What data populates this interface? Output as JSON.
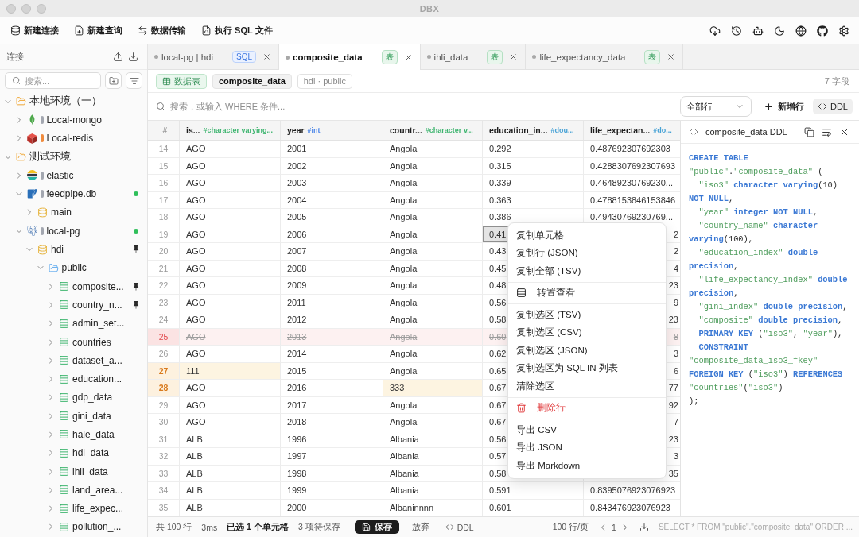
{
  "window": {
    "title": "DBX"
  },
  "toolbar": {
    "actions": [
      {
        "kind": "new-connection",
        "label": "新建连接"
      },
      {
        "kind": "new-query",
        "label": "新建查询"
      },
      {
        "kind": "transfer",
        "label": "数据传输"
      },
      {
        "kind": "run-file",
        "label": "执行 SQL 文件"
      }
    ]
  },
  "sidebar": {
    "title": "连接",
    "search": {
      "placeholder": "搜索..."
    },
    "tree": [
      {
        "kind": "group",
        "label": "本地环境（一）",
        "expanded": true,
        "children": [
          {
            "kind": "mongodb",
            "label": "Local-mongo",
            "color": "#a3a7b0",
            "expanded": false,
            "connected": false
          },
          {
            "kind": "redis",
            "label": "Local-redis",
            "color": "#ef8a3c",
            "expanded": false,
            "connected": false
          }
        ]
      },
      {
        "kind": "group",
        "label": "测试环境",
        "expanded": true,
        "children": [
          {
            "kind": "elasticsearch",
            "label": "elastic",
            "color": "#a3a7b0",
            "expanded": false,
            "connected": false
          },
          {
            "kind": "sqlite",
            "label": "feedpipe.db",
            "color": "#a3a7b0",
            "expanded": true,
            "connected": true,
            "children": [
              {
                "kind": "database",
                "label": "main",
                "expanded": false,
                "pinned": false
              }
            ]
          },
          {
            "kind": "postgres",
            "label": "local-pg",
            "color": "#a3a7b0",
            "expanded": true,
            "connected": true,
            "children": [
              {
                "kind": "database",
                "label": "hdi",
                "expanded": true,
                "pinned": true,
                "children": [
                  {
                    "kind": "schema",
                    "label": "public",
                    "expanded": true,
                    "children": [
                      {
                        "kind": "table",
                        "label": "composite...",
                        "expanded": false,
                        "pinned": true
                      },
                      {
                        "kind": "table",
                        "label": "country_n...",
                        "expanded": false,
                        "pinned": true
                      },
                      {
                        "kind": "table",
                        "label": "admin_set...",
                        "expanded": false,
                        "pinned": false
                      },
                      {
                        "kind": "table",
                        "label": "countries",
                        "expanded": false,
                        "pinned": false
                      },
                      {
                        "kind": "table",
                        "label": "dataset_a...",
                        "expanded": false,
                        "pinned": false
                      },
                      {
                        "kind": "table",
                        "label": "education...",
                        "expanded": false,
                        "pinned": false
                      },
                      {
                        "kind": "table",
                        "label": "gdp_data",
                        "expanded": false,
                        "pinned": false
                      },
                      {
                        "kind": "table",
                        "label": "gini_data",
                        "expanded": false,
                        "pinned": false
                      },
                      {
                        "kind": "table",
                        "label": "hale_data",
                        "expanded": false,
                        "pinned": false
                      },
                      {
                        "kind": "table",
                        "label": "hdi_data",
                        "expanded": false,
                        "pinned": false
                      },
                      {
                        "kind": "table",
                        "label": "ihli_data",
                        "expanded": false,
                        "pinned": false
                      },
                      {
                        "kind": "table",
                        "label": "land_area...",
                        "expanded": false,
                        "pinned": false
                      },
                      {
                        "kind": "table",
                        "label": "life_expec...",
                        "expanded": false,
                        "pinned": false
                      },
                      {
                        "kind": "table",
                        "label": "pollution_...",
                        "expanded": false,
                        "pinned": false
                      }
                    ]
                  }
                ]
              }
            ]
          }
        ]
      }
    ]
  },
  "tabs": [
    {
      "label": "local-pg | hdi",
      "badge": "SQL",
      "kind": "sql",
      "selected": false
    },
    {
      "label": "composite_data",
      "badge": "表",
      "kind": "table",
      "selected": true
    },
    {
      "label": "ihli_data",
      "badge": "表",
      "kind": "table",
      "selected": false
    },
    {
      "label": "life_expectancy_data",
      "badge": "表",
      "kind": "table",
      "selected": false
    }
  ],
  "object_bar": {
    "type_chip": "数据表",
    "name_chip": "composite_data",
    "path_chip": "hdi · public",
    "field_count": "7 字段"
  },
  "filter_bar": {
    "placeholder": "搜索，或输入 WHERE 条件...",
    "row_filter": "全部行",
    "add_row": "新增行",
    "ddl_toggle": {
      "label": "DDL",
      "on": true
    }
  },
  "table": {
    "number_header": "#",
    "columns": [
      {
        "label": "is...",
        "type": "#character varying...",
        "color": "#3cb46e"
      },
      {
        "label": "year",
        "type": "#int",
        "color": "#4c86e8"
      },
      {
        "label": "countr...",
        "type": "#character v...",
        "color": "#3cb46e"
      },
      {
        "label": "education_in...",
        "type": "#dou...",
        "color": "#49a3d6"
      },
      {
        "label": "life_expectan...",
        "type": "#do...",
        "color": "#49a3d6"
      }
    ],
    "rows": [
      {
        "number": "14",
        "deleted": false,
        "modified": false,
        "under_menu": false,
        "cells": [
          {
            "text": "AGO",
            "selected": false,
            "edited": false
          },
          {
            "text": "2001",
            "selected": false,
            "edited": false
          },
          {
            "text": "Angola",
            "selected": false,
            "edited": false
          },
          {
            "text": "0.292",
            "selected": false,
            "edited": false
          },
          {
            "text": "0.487692307692303",
            "selected": false,
            "edited": false
          }
        ]
      },
      {
        "number": "15",
        "deleted": false,
        "modified": false,
        "under_menu": false,
        "cells": [
          {
            "text": "AGO",
            "selected": false,
            "edited": false
          },
          {
            "text": "2002",
            "selected": false,
            "edited": false
          },
          {
            "text": "Angola",
            "selected": false,
            "edited": false
          },
          {
            "text": "0.315",
            "selected": false,
            "edited": false
          },
          {
            "text": "0.4288307692307693",
            "selected": false,
            "edited": false
          }
        ]
      },
      {
        "number": "16",
        "deleted": false,
        "modified": false,
        "under_menu": false,
        "cells": [
          {
            "text": "AGO",
            "selected": false,
            "edited": false
          },
          {
            "text": "2003",
            "selected": false,
            "edited": false
          },
          {
            "text": "Angola",
            "selected": false,
            "edited": false
          },
          {
            "text": "0.339",
            "selected": false,
            "edited": false
          },
          {
            "text": "0.46489230769230...",
            "selected": false,
            "edited": false
          }
        ]
      },
      {
        "number": "17",
        "deleted": false,
        "modified": false,
        "under_menu": false,
        "cells": [
          {
            "text": "AGO",
            "selected": false,
            "edited": false
          },
          {
            "text": "2004",
            "selected": false,
            "edited": false
          },
          {
            "text": "Angola",
            "selected": false,
            "edited": false
          },
          {
            "text": "0.363",
            "selected": false,
            "edited": false
          },
          {
            "text": "0.4788153846153846",
            "selected": false,
            "edited": false
          }
        ]
      },
      {
        "number": "18",
        "deleted": false,
        "modified": false,
        "under_menu": false,
        "cells": [
          {
            "text": "AGO",
            "selected": false,
            "edited": false
          },
          {
            "text": "2005",
            "selected": false,
            "edited": false
          },
          {
            "text": "Angola",
            "selected": false,
            "edited": false
          },
          {
            "text": "0.386",
            "selected": false,
            "edited": false
          },
          {
            "text": "0.49430769230769...",
            "selected": false,
            "edited": false
          }
        ]
      },
      {
        "number": "19",
        "deleted": false,
        "modified": false,
        "under_menu": true,
        "cells": [
          {
            "text": "AGO",
            "selected": false,
            "edited": false
          },
          {
            "text": "2006",
            "selected": false,
            "edited": false
          },
          {
            "text": "Angola",
            "selected": false,
            "edited": false
          },
          {
            "text": "0.41",
            "selected": true,
            "edited": false
          },
          {
            "text": "2",
            "selected": false,
            "edited": false
          }
        ]
      },
      {
        "number": "20",
        "deleted": false,
        "modified": false,
        "under_menu": true,
        "cells": [
          {
            "text": "AGO",
            "selected": false,
            "edited": false
          },
          {
            "text": "2007",
            "selected": false,
            "edited": false
          },
          {
            "text": "Angola",
            "selected": false,
            "edited": false
          },
          {
            "text": "0.43",
            "selected": false,
            "edited": false
          },
          {
            "text": "2",
            "selected": false,
            "edited": false
          }
        ]
      },
      {
        "number": "21",
        "deleted": false,
        "modified": false,
        "under_menu": true,
        "cells": [
          {
            "text": "AGO",
            "selected": false,
            "edited": false
          },
          {
            "text": "2008",
            "selected": false,
            "edited": false
          },
          {
            "text": "Angola",
            "selected": false,
            "edited": false
          },
          {
            "text": "0.45",
            "selected": false,
            "edited": false
          },
          {
            "text": "4",
            "selected": false,
            "edited": false
          }
        ]
      },
      {
        "number": "22",
        "deleted": false,
        "modified": false,
        "under_menu": true,
        "cells": [
          {
            "text": "AGO",
            "selected": false,
            "edited": false
          },
          {
            "text": "2009",
            "selected": false,
            "edited": false
          },
          {
            "text": "Angola",
            "selected": false,
            "edited": false
          },
          {
            "text": "0.48",
            "selected": false,
            "edited": false
          },
          {
            "text": "23",
            "selected": false,
            "edited": false
          }
        ]
      },
      {
        "number": "23",
        "deleted": false,
        "modified": false,
        "under_menu": true,
        "cells": [
          {
            "text": "AGO",
            "selected": false,
            "edited": false
          },
          {
            "text": "2011",
            "selected": false,
            "edited": false
          },
          {
            "text": "Angola",
            "selected": false,
            "edited": false
          },
          {
            "text": "0.56",
            "selected": false,
            "edited": false
          },
          {
            "text": "9",
            "selected": false,
            "edited": false
          }
        ]
      },
      {
        "number": "24",
        "deleted": false,
        "modified": false,
        "under_menu": true,
        "cells": [
          {
            "text": "AGO",
            "selected": false,
            "edited": false
          },
          {
            "text": "2012",
            "selected": false,
            "edited": false
          },
          {
            "text": "Angola",
            "selected": false,
            "edited": false
          },
          {
            "text": "0.58",
            "selected": false,
            "edited": false
          },
          {
            "text": "23",
            "selected": false,
            "edited": false
          }
        ]
      },
      {
        "number": "25",
        "deleted": true,
        "modified": false,
        "under_menu": true,
        "cells": [
          {
            "text": "AGO",
            "selected": false,
            "edited": false
          },
          {
            "text": "2013",
            "selected": false,
            "edited": false
          },
          {
            "text": "Angola",
            "selected": false,
            "edited": false
          },
          {
            "text": "0.60",
            "selected": false,
            "edited": false
          },
          {
            "text": "8",
            "selected": false,
            "edited": false
          }
        ]
      },
      {
        "number": "26",
        "deleted": false,
        "modified": false,
        "under_menu": true,
        "cells": [
          {
            "text": "AGO",
            "selected": false,
            "edited": false
          },
          {
            "text": "2014",
            "selected": false,
            "edited": false
          },
          {
            "text": "Angola",
            "selected": false,
            "edited": false
          },
          {
            "text": "0.62",
            "selected": false,
            "edited": false
          },
          {
            "text": "3",
            "selected": false,
            "edited": false
          }
        ]
      },
      {
        "number": "27",
        "deleted": false,
        "modified": true,
        "under_menu": true,
        "cells": [
          {
            "text": "111",
            "selected": false,
            "edited": true
          },
          {
            "text": "2015",
            "selected": false,
            "edited": false
          },
          {
            "text": "Angola",
            "selected": false,
            "edited": false
          },
          {
            "text": "0.65",
            "selected": false,
            "edited": false
          },
          {
            "text": "6",
            "selected": false,
            "edited": false
          }
        ]
      },
      {
        "number": "28",
        "deleted": false,
        "modified": true,
        "under_menu": true,
        "cells": [
          {
            "text": "AGO",
            "selected": false,
            "edited": false
          },
          {
            "text": "2016",
            "selected": false,
            "edited": false
          },
          {
            "text": "333",
            "selected": false,
            "edited": true
          },
          {
            "text": "0.67",
            "selected": false,
            "edited": false
          },
          {
            "text": "77",
            "selected": false,
            "edited": false
          }
        ]
      },
      {
        "number": "29",
        "deleted": false,
        "modified": false,
        "under_menu": true,
        "cells": [
          {
            "text": "AGO",
            "selected": false,
            "edited": false
          },
          {
            "text": "2017",
            "selected": false,
            "edited": false
          },
          {
            "text": "Angola",
            "selected": false,
            "edited": false
          },
          {
            "text": "0.67",
            "selected": false,
            "edited": false
          },
          {
            "text": "92",
            "selected": false,
            "edited": false
          }
        ]
      },
      {
        "number": "30",
        "deleted": false,
        "modified": false,
        "under_menu": true,
        "cells": [
          {
            "text": "AGO",
            "selected": false,
            "edited": false
          },
          {
            "text": "2018",
            "selected": false,
            "edited": false
          },
          {
            "text": "Angola",
            "selected": false,
            "edited": false
          },
          {
            "text": "0.67",
            "selected": false,
            "edited": false
          },
          {
            "text": "7",
            "selected": false,
            "edited": false
          }
        ]
      },
      {
        "number": "31",
        "deleted": false,
        "modified": false,
        "under_menu": true,
        "cells": [
          {
            "text": "ALB",
            "selected": false,
            "edited": false
          },
          {
            "text": "1996",
            "selected": false,
            "edited": false
          },
          {
            "text": "Albania",
            "selected": false,
            "edited": false
          },
          {
            "text": "0.56",
            "selected": false,
            "edited": false
          },
          {
            "text": "23",
            "selected": false,
            "edited": false
          }
        ]
      },
      {
        "number": "32",
        "deleted": false,
        "modified": false,
        "under_menu": true,
        "cells": [
          {
            "text": "ALB",
            "selected": false,
            "edited": false
          },
          {
            "text": "1997",
            "selected": false,
            "edited": false
          },
          {
            "text": "Albania",
            "selected": false,
            "edited": false
          },
          {
            "text": "0.57",
            "selected": false,
            "edited": false
          },
          {
            "text": "3",
            "selected": false,
            "edited": false
          }
        ]
      },
      {
        "number": "33",
        "deleted": false,
        "modified": false,
        "under_menu": true,
        "cells": [
          {
            "text": "ALB",
            "selected": false,
            "edited": false
          },
          {
            "text": "1998",
            "selected": false,
            "edited": false
          },
          {
            "text": "Albania",
            "selected": false,
            "edited": false
          },
          {
            "text": "0.58",
            "selected": false,
            "edited": false
          },
          {
            "text": "35",
            "selected": false,
            "edited": false
          }
        ]
      },
      {
        "number": "34",
        "deleted": false,
        "modified": false,
        "under_menu": false,
        "cells": [
          {
            "text": "ALB",
            "selected": false,
            "edited": false
          },
          {
            "text": "1999",
            "selected": false,
            "edited": false
          },
          {
            "text": "Albania",
            "selected": false,
            "edited": false
          },
          {
            "text": "0.591",
            "selected": false,
            "edited": false
          },
          {
            "text": "0.8395076923076923",
            "selected": false,
            "edited": false
          }
        ]
      },
      {
        "number": "35",
        "deleted": false,
        "modified": false,
        "under_menu": false,
        "cells": [
          {
            "text": "ALB",
            "selected": false,
            "edited": false
          },
          {
            "text": "2000",
            "selected": false,
            "edited": false
          },
          {
            "text": "Albaninnnn",
            "selected": false,
            "edited": false
          },
          {
            "text": "0.601",
            "selected": false,
            "edited": false
          },
          {
            "text": "0.843476923076923",
            "selected": false,
            "edited": false
          }
        ]
      }
    ]
  },
  "context_menu": {
    "sections": [
      {
        "items": [
          {
            "kind": "plain",
            "label": "复制单元格"
          },
          {
            "kind": "plain",
            "label": "复制行 (JSON)"
          },
          {
            "kind": "plain",
            "label": "复制全部 (TSV)"
          }
        ]
      },
      {
        "items": [
          {
            "kind": "transpose",
            "label": "转置查看"
          }
        ]
      },
      {
        "items": [
          {
            "kind": "plain",
            "label": "复制选区 (TSV)"
          },
          {
            "kind": "plain",
            "label": "复制选区 (CSV)"
          },
          {
            "kind": "plain",
            "label": "复制选区 (JSON)"
          },
          {
            "kind": "plain",
            "label": "复制选区为 SQL IN 列表"
          },
          {
            "kind": "plain",
            "label": "清除选区"
          }
        ]
      },
      {
        "items": [
          {
            "kind": "danger",
            "label": "删除行"
          }
        ]
      },
      {
        "items": [
          {
            "kind": "plain",
            "label": "导出 CSV"
          },
          {
            "kind": "plain",
            "label": "导出 JSON"
          },
          {
            "kind": "plain",
            "label": "导出 Markdown"
          }
        ]
      }
    ]
  },
  "ddl_panel": {
    "title": "composite_data DDL",
    "lines": [
      [
        {
          "kind": "keyword",
          "text": "CREATE TABLE"
        }
      ],
      [
        {
          "kind": "string",
          "text": "\"public\""
        },
        {
          "kind": "plain",
          "text": "."
        },
        {
          "kind": "string",
          "text": "\"composite_data\""
        },
        {
          "kind": "plain",
          "text": " ("
        }
      ],
      [
        {
          "kind": "string",
          "text": "  \"iso3\""
        },
        {
          "kind": "keyword",
          "text": " character varying"
        },
        {
          "kind": "plain",
          "text": "(10)"
        }
      ],
      [
        {
          "kind": "keyword",
          "text": "NOT NULL"
        },
        {
          "kind": "plain",
          "text": ","
        }
      ],
      [
        {
          "kind": "string",
          "text": "  \"year\""
        },
        {
          "kind": "keyword",
          "text": " integer NOT NULL"
        },
        {
          "kind": "plain",
          "text": ","
        }
      ],
      [
        {
          "kind": "string",
          "text": "  \"country_name\""
        },
        {
          "kind": "keyword",
          "text": " character"
        }
      ],
      [
        {
          "kind": "keyword",
          "text": "varying"
        },
        {
          "kind": "plain",
          "text": "(100),"
        }
      ],
      [
        {
          "kind": "string",
          "text": "  \"education_index\""
        },
        {
          "kind": "keyword",
          "text": " double"
        }
      ],
      [
        {
          "kind": "keyword",
          "text": "precision"
        },
        {
          "kind": "plain",
          "text": ","
        }
      ],
      [
        {
          "kind": "string",
          "text": "  \"life_expectancy_index\""
        },
        {
          "kind": "keyword",
          "text": " double"
        }
      ],
      [
        {
          "kind": "keyword",
          "text": "precision"
        },
        {
          "kind": "plain",
          "text": ","
        }
      ],
      [
        {
          "kind": "string",
          "text": "  \"gini_index\""
        },
        {
          "kind": "keyword",
          "text": " double precision"
        },
        {
          "kind": "plain",
          "text": ","
        }
      ],
      [
        {
          "kind": "string",
          "text": "  \"composite\""
        },
        {
          "kind": "keyword",
          "text": " double precision"
        },
        {
          "kind": "plain",
          "text": ","
        }
      ],
      [
        {
          "kind": "keyword",
          "text": "  PRIMARY KEY"
        },
        {
          "kind": "plain",
          "text": " ("
        },
        {
          "kind": "string",
          "text": "\"iso3\""
        },
        {
          "kind": "plain",
          "text": ", "
        },
        {
          "kind": "string",
          "text": "\"year\""
        },
        {
          "kind": "plain",
          "text": "),"
        }
      ],
      [
        {
          "kind": "keyword",
          "text": "  CONSTRAINT"
        }
      ],
      [
        {
          "kind": "string",
          "text": "\"composite_data_iso3_fkey\""
        }
      ],
      [
        {
          "kind": "keyword",
          "text": "FOREIGN KEY"
        },
        {
          "kind": "plain",
          "text": " ("
        },
        {
          "kind": "string",
          "text": "\"iso3\""
        },
        {
          "kind": "plain",
          "text": ") "
        },
        {
          "kind": "keyword",
          "text": "REFERENCES"
        }
      ],
      [
        {
          "kind": "string",
          "text": "\"countries\""
        },
        {
          "kind": "plain",
          "text": "("
        },
        {
          "kind": "string",
          "text": "\"iso3\""
        },
        {
          "kind": "plain",
          "text": ")"
        }
      ],
      [
        {
          "kind": "plain",
          "text": ");"
        }
      ]
    ]
  },
  "status_bar": {
    "total": "共 100 行",
    "time": "3ms",
    "selection": "已选 1 个单元格",
    "pending": "3 项待保存",
    "save": "保存",
    "discard": "放弃",
    "ddl": "DDL",
    "page_size": "100 行/页",
    "page": "1",
    "query": "SELECT * FROM \"public\".\"composite_data\" ORDER ..."
  }
}
